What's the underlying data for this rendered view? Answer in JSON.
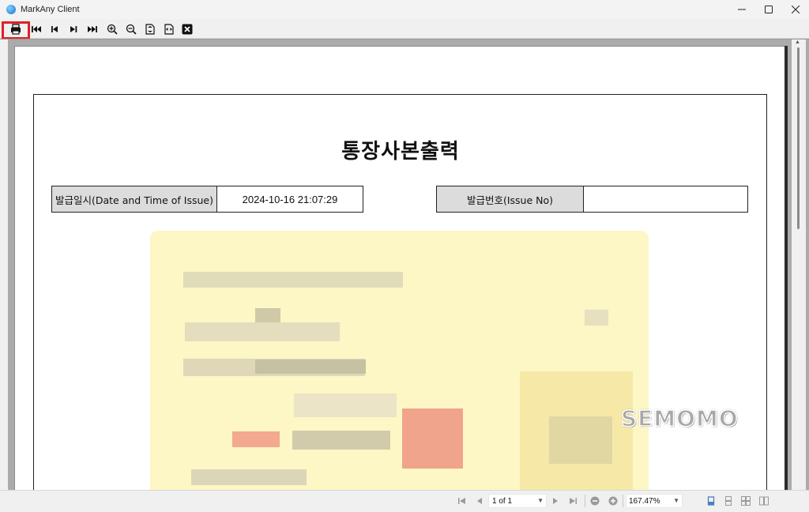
{
  "window": {
    "title": "MarkAny Client",
    "minimize": "─",
    "maximize": "☐",
    "close": "✕"
  },
  "toolbar": {
    "buttons": [
      {
        "name": "print-button",
        "icon": "printer-icon",
        "highlighted": true
      },
      {
        "name": "first-page-button",
        "icon": "first-page-icon"
      },
      {
        "name": "previous-page-button",
        "icon": "previous-page-icon"
      },
      {
        "name": "next-page-button",
        "icon": "next-page-icon"
      },
      {
        "name": "last-page-button",
        "icon": "last-page-icon"
      },
      {
        "name": "zoom-in-button",
        "icon": "zoom-in-icon"
      },
      {
        "name": "zoom-out-button",
        "icon": "zoom-out-icon"
      },
      {
        "name": "fit-page-button",
        "icon": "fit-page-icon"
      },
      {
        "name": "fit-width-button",
        "icon": "fit-width-icon"
      },
      {
        "name": "close-document-button",
        "icon": "close-icon"
      }
    ],
    "highlight_color": "#e0202a"
  },
  "document": {
    "title": "통장사본출력",
    "issue_datetime_label": "발급일시(Date and Time of Issue)",
    "issue_datetime_value": "2024-10-16 21:07:29",
    "issue_no_label": "발급번호(Issue No)",
    "issue_no_value": ""
  },
  "watermark": "SEMOMO",
  "statusbar": {
    "page_indicator": "1 of 1",
    "zoom_level": "167.47%"
  },
  "colors": {
    "passbook_background": "#fdf6c5",
    "label_background": "#dcdcdc"
  }
}
